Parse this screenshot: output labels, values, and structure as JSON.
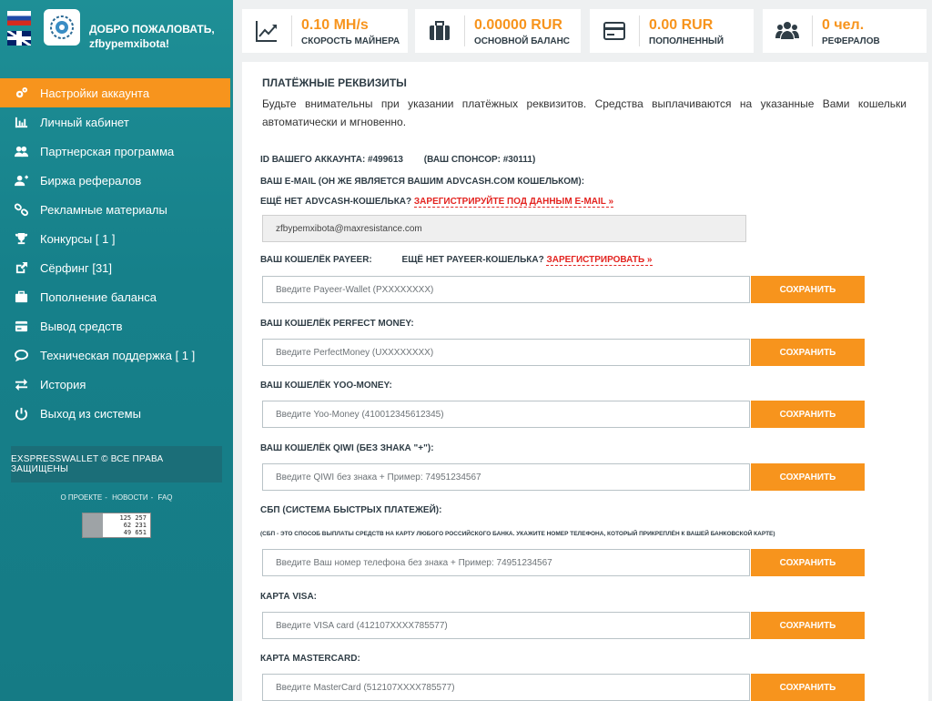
{
  "sidebar": {
    "welcome_line1": "ДОБРО ПОЖАЛОВАТЬ,",
    "welcome_line2": "zfbypemxibota!",
    "menu": [
      {
        "label": "Настройки аккаунта",
        "icon": "gears-icon",
        "active": true
      },
      {
        "label": "Личный кабинет",
        "icon": "bar-chart-icon"
      },
      {
        "label": "Партнерская программа",
        "icon": "users-icon"
      },
      {
        "label": "Биржа рефералов",
        "icon": "user-plus-icon"
      },
      {
        "label": "Рекламные материалы",
        "icon": "link-icon"
      },
      {
        "label": "Конкурсы [ 1 ]",
        "icon": "trophy-icon"
      },
      {
        "label": "Сёрфинг [31]",
        "icon": "external-link-icon"
      },
      {
        "label": "Пополнение баланса",
        "icon": "briefcase-icon"
      },
      {
        "label": "Вывод средств",
        "icon": "credit-card-icon"
      },
      {
        "label": "Техническая поддержка [ 1 ]",
        "icon": "chat-icon"
      },
      {
        "label": "История",
        "icon": "exchange-icon"
      },
      {
        "label": "Выход из системы",
        "icon": "power-icon"
      }
    ],
    "copyright": "EXSPRESSWALLET © ВСЕ ПРАВА ЗАЩИЩЕНЫ",
    "links": [
      "О ПРОЕКТЕ",
      "НОВОСТИ",
      "FAQ"
    ],
    "counter": [
      "125 257",
      "62 231",
      "49 651"
    ]
  },
  "stats": [
    {
      "value": "0.10 MH/s",
      "label": "СКОРОСТЬ МАЙНЕРА",
      "icon": "line-chart-icon"
    },
    {
      "value": "0.00000 RUR",
      "label": "ОСНОВНОЙ БАЛАНС",
      "icon": "briefcase-icon"
    },
    {
      "value": "0.00 RUR",
      "label": "ПОПОЛНЕННЫЙ",
      "icon": "credit-card-icon"
    },
    {
      "value": "0 чел.",
      "label": "РЕФЕРАЛОВ",
      "icon": "users-icon"
    }
  ],
  "main": {
    "title": "ПЛАТЁЖНЫЕ РЕКВИЗИТЫ",
    "description": "Будьте внимательны при указании платёжных реквизитов. Средства выплачиваются на указанные Вами кошельки автоматически и мгновенно.",
    "account_id": "ID ВАШЕГО АККАУНТА: #499613",
    "sponsor": "(ВАШ СПОНСОР: #30111)",
    "email_label": "ВАШ E-MAIL (ОН ЖЕ ЯВЛЯЕТСЯ ВАШИМ ADVCASH.COM КОШЕЛЬКОМ):",
    "advcash_prompt": "ЕЩЁ НЕТ ADVCASH-КОШЕЛЬКА?",
    "advcash_link": "ЗАРЕГИСТРИРУЙТЕ ПОД ДАННЫМ E-MAIL »",
    "email_value": "zfbypemxibota@maxresistance.com",
    "payeer_label": "ВАШ КОШЕЛЁК PAYEER:",
    "payeer_prompt": "ЕЩЁ НЕТ PAYEER-КОШЕЛЬКА?",
    "payeer_link": "ЗАРЕГИСТРИРОВАТЬ »",
    "payeer_placeholder": "Введите Payeer-Wallet (PXXXXXXXX)",
    "pm_label": "ВАШ КОШЕЛЁК PERFECT MONEY:",
    "pm_placeholder": "Введите PerfectMoney (UXXXXXXXX)",
    "yoo_label": "ВАШ КОШЕЛЁК YOO-MONEY:",
    "yoo_placeholder": "Введите Yoo-Money (410012345612345)",
    "qiwi_label": "ВАШ КОШЕЛЁК QIWI (БЕЗ ЗНАКА \"+\"):",
    "qiwi_placeholder": "Введите QIWI без знака + Пример: 74951234567",
    "sbp_label": "СБП (СИСТЕМА БЫСТРЫХ ПЛАТЕЖЕЙ):",
    "sbp_note": "(СБП - ЭТО СПОСОБ ВЫПЛАТЫ СРЕДСТВ НА КАРТУ ЛЮБОГО РОССИЙСКОГО БАНКА. УКАЖИТЕ НОМЕР ТЕЛЕФОНА, КОТОРЫЙ ПРИКРЕПЛЁН К ВАШЕЙ БАНКОВСКОЙ КАРТЕ)",
    "sbp_placeholder": "Введите Ваш номер телефона без знака + Пример: 74951234567",
    "visa_label": "КАРТА VISA:",
    "visa_placeholder": "Введите VISA card (412107XXXX785577)",
    "mc_label": "КАРТА MASTERCARD:",
    "mc_placeholder": "Введите MasterCard (512107XXXX785577)",
    "save_label": "СОХРАНИТЬ"
  },
  "colors": {
    "accent": "#f7941d",
    "sidebar": "#178590",
    "link": "#e32420"
  }
}
